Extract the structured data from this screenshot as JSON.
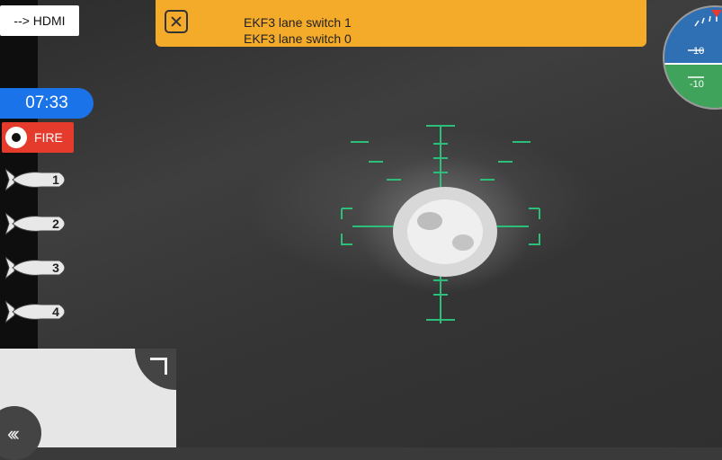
{
  "top_left": {
    "hdmi_label": "--> HDMI"
  },
  "notification": {
    "lines": [
      "EKF3 lane switch 1",
      "EKF3 lane switch 0"
    ]
  },
  "timer": {
    "value": "07:33"
  },
  "fire_button": {
    "label": "FIRE"
  },
  "munitions": [
    {
      "label": "1"
    },
    {
      "label": "2"
    },
    {
      "label": "3"
    },
    {
      "label": "4"
    }
  ],
  "attitude_indicator": {
    "pitch_up_label": "10",
    "pitch_down_label": "-10",
    "sky_color": "#2f6fb3",
    "ground_color": "#3fa35b"
  },
  "colors": {
    "notice": "#f4ab2a",
    "timer": "#1a73e8",
    "fire": "#e53b2d",
    "reticle": "#2bbf7a"
  }
}
